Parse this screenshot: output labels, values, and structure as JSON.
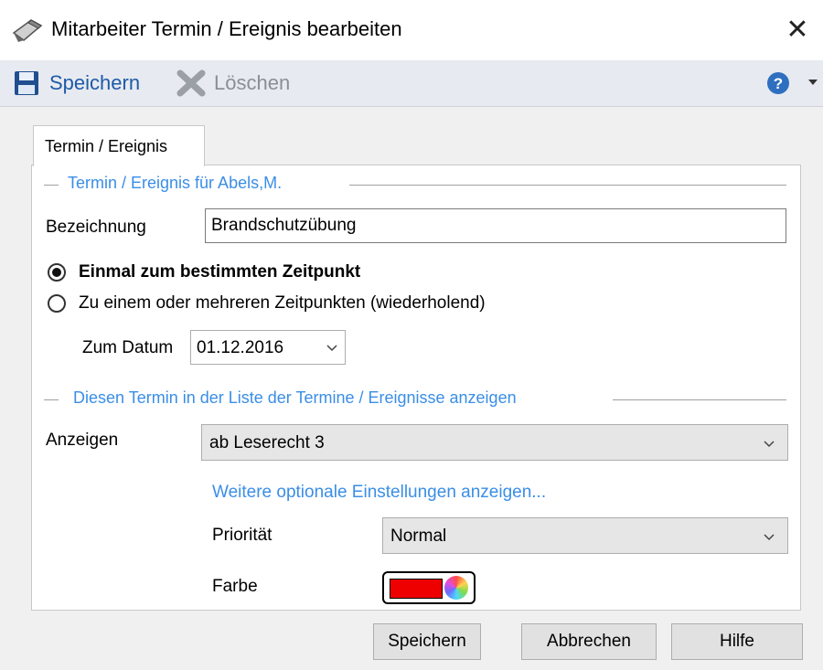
{
  "window": {
    "title": "Mitarbeiter Termin / Ereignis bearbeiten",
    "close_glyph": "✕"
  },
  "toolbar": {
    "save_label": "Speichern",
    "delete_label": "Löschen",
    "help_icon": "help-icon"
  },
  "tab": {
    "label": "Termin / Ereignis"
  },
  "group1": {
    "title": "Termin / Ereignis für Abels,M."
  },
  "bezeichnung": {
    "label": "Bezeichnung",
    "value": "Brandschutzübung"
  },
  "radio_once": {
    "label": "Einmal zum bestimmten Zeitpunkt",
    "checked": true
  },
  "radio_repeat": {
    "label": "Zu einem oder mehreren Zeitpunkten (wiederholend)",
    "checked": false
  },
  "datum": {
    "label": "Zum Datum",
    "value": "01.12.2016"
  },
  "group2": {
    "title": "Diesen Termin in der Liste der Termine / Ereignisse anzeigen"
  },
  "anzeigen": {
    "label": "Anzeigen",
    "value": "ab Leserecht 3"
  },
  "more_link": "Weitere optionale Einstellungen anzeigen...",
  "prioritaet": {
    "label": "Priorität",
    "value": "Normal"
  },
  "farbe": {
    "label": "Farbe",
    "color": "#ee0000"
  },
  "buttons": {
    "save": "Speichern",
    "cancel": "Abbrechen",
    "help": "Hilfe"
  }
}
